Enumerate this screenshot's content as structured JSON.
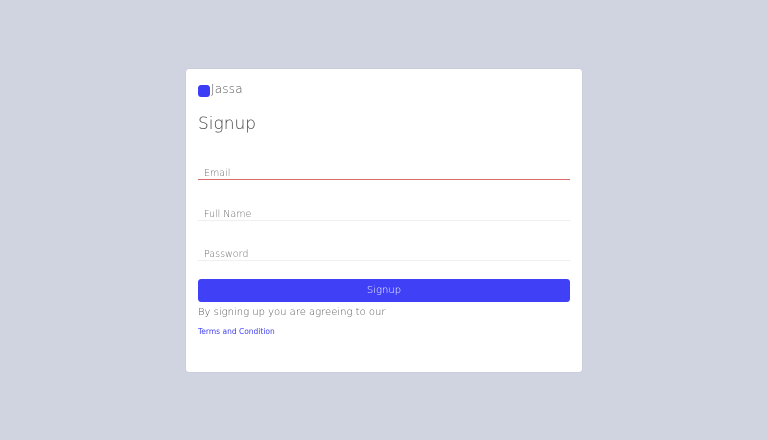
{
  "brand": {
    "name": "Jassa",
    "accent_color": "#3d3df5"
  },
  "form": {
    "title": "Signup",
    "email_placeholder": "Email",
    "email_value": "",
    "fullname_placeholder": "Full Name",
    "fullname_value": "",
    "password_placeholder": "Password",
    "password_value": "",
    "submit_label": "Signup",
    "agree_text": "By signing up you are agreeing to our",
    "terms_link": "Terms and Condition"
  },
  "colors": {
    "background": "#cfd4e0",
    "card": "#ffffff",
    "button": "#4040f7",
    "email_underline_error": "#d96a6a"
  }
}
